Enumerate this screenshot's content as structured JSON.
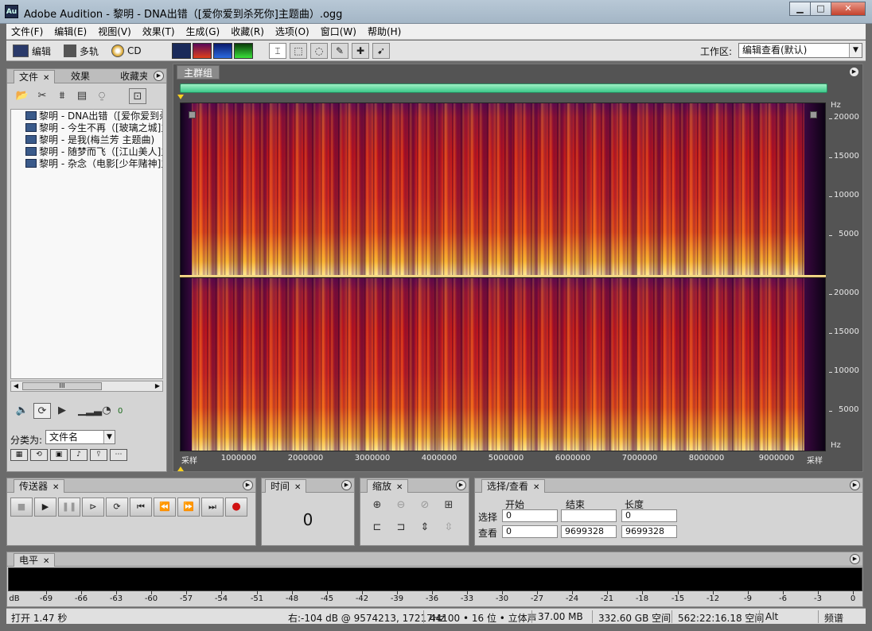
{
  "window": {
    "app_icon": "Au",
    "title": "Adobe Audition - 黎明 - DNA出错（[爱你爱到杀死你]主题曲）.ogg",
    "min": "▁",
    "max": "□",
    "close": "✕"
  },
  "menu": [
    "文件(F)",
    "编辑(E)",
    "视图(V)",
    "效果(T)",
    "生成(G)",
    "收藏(R)",
    "选项(O)",
    "窗口(W)",
    "帮助(H)"
  ],
  "toolbar": {
    "mode_edit": "编辑",
    "mode_multitrack": "多轨",
    "mode_cd": "CD",
    "workspace_label": "工作区:",
    "workspace_value": "编辑查看(默认)"
  },
  "files_panel": {
    "tabs": [
      "文件",
      "效果",
      "收藏夹"
    ],
    "files": [
      "黎明 - DNA出错（[爱你爱到杀死你]主题曲）",
      "黎明 - 今生不再（[玻璃之城]主题曲）",
      "黎明 - 是我(梅兰芳 主题曲)",
      "黎明 - 随梦而飞（[江山美人]主题曲）",
      "黎明 - 杂念（电影[少年赌神]主题曲）"
    ],
    "scroll_thumb": "III",
    "volume_value": "0",
    "classify_label": "分类为:",
    "classify_value": "文件名"
  },
  "editor": {
    "tab": "主群组",
    "hz_unit": "Hz",
    "hz_ticks_ch1": [
      "20000",
      "15000",
      "10000",
      "5000"
    ],
    "hz_ticks_ch2": [
      "20000",
      "15000",
      "10000",
      "5000"
    ],
    "time_unit": "采样",
    "time_ticks": [
      "1000000",
      "2000000",
      "3000000",
      "4000000",
      "5000000",
      "6000000",
      "7000000",
      "8000000",
      "9000000"
    ]
  },
  "transport_panel": {
    "title": "传送器"
  },
  "time_panel": {
    "title": "时间",
    "value": "0"
  },
  "zoom_panel": {
    "title": "缩放"
  },
  "selection_panel": {
    "title": "选择/查看",
    "col_start": "开始",
    "col_end": "结束",
    "col_length": "长度",
    "row_select": "选择",
    "row_view": "查看",
    "select_start": "0",
    "select_end": "",
    "select_length": "0",
    "view_start": "0",
    "view_end": "9699328",
    "view_length": "9699328"
  },
  "level_panel": {
    "title": "电平",
    "db_unit": "dB",
    "db_ticks": [
      "-69",
      "-66",
      "-63",
      "-60",
      "-57",
      "-54",
      "-51",
      "-48",
      "-45",
      "-42",
      "-39",
      "-36",
      "-33",
      "-30",
      "-27",
      "-24",
      "-21",
      "-18",
      "-15",
      "-12",
      "-9",
      "-6",
      "-3",
      "0"
    ]
  },
  "status": {
    "open_time": "打开 1.47 秒",
    "cursor": "右:-104 dB @ 9574213, 17217Hz",
    "format": "44100 • 16 位 • 立体声",
    "file_size": "37.00 MB",
    "free_space": "332.60 GB 空间",
    "free_time": "562:22:16.18 空间",
    "alt": "Alt",
    "view_mode": "频谱"
  },
  "colors": {
    "overview": "#3cc88a",
    "spectrum_hot": "#fff0a0",
    "spectrum_mid": "#d8281a",
    "spectrum_cold": "#3a0840",
    "record": "#d01010"
  }
}
